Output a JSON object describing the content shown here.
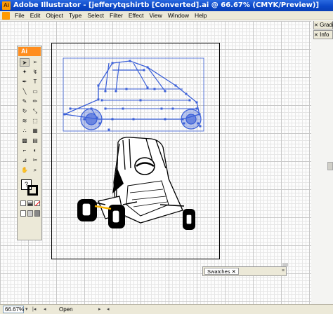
{
  "window": {
    "title": "Adobe Illustrator - [jefferytqshirtb [Converted].ai @ 66.67% (CMYK/Preview)]",
    "app_icon_label": "Ai"
  },
  "menu": {
    "items": [
      "File",
      "Edit",
      "Object",
      "Type",
      "Select",
      "Filter",
      "Effect",
      "View",
      "Window",
      "Help"
    ]
  },
  "tools_panel": {
    "logo": "Ai",
    "text_tool_glyph": "T",
    "help_glyph": "?"
  },
  "panels": {
    "gradient_tab": "Gradie",
    "info_tab": "Info",
    "swatches_tab": "Swatches",
    "close_glyph": "✕",
    "grip_glyph": "≡"
  },
  "status": {
    "zoom": "66.67%",
    "text": "Open"
  },
  "colors": {
    "selection": "#3a5fd8",
    "titlebar": "#0b48c8",
    "ai_orange": "#ff8d1e"
  },
  "icons": [
    "illustrator-app-icon",
    "selection-arrow-icon",
    "direct-selection-icon",
    "magic-wand-icon",
    "lasso-icon",
    "pen-icon",
    "type-icon",
    "line-icon",
    "rectangle-icon",
    "paintbrush-icon",
    "pencil-icon",
    "rotate-icon",
    "scale-icon",
    "warp-icon",
    "free-transform-icon",
    "symbol-sprayer-icon",
    "graph-icon",
    "mesh-icon",
    "gradient-icon",
    "eyedropper-icon",
    "blend-icon",
    "slice-icon",
    "scissors-icon",
    "hand-icon",
    "zoom-icon",
    "fill-stroke-icon",
    "screen-mode-icon"
  ]
}
